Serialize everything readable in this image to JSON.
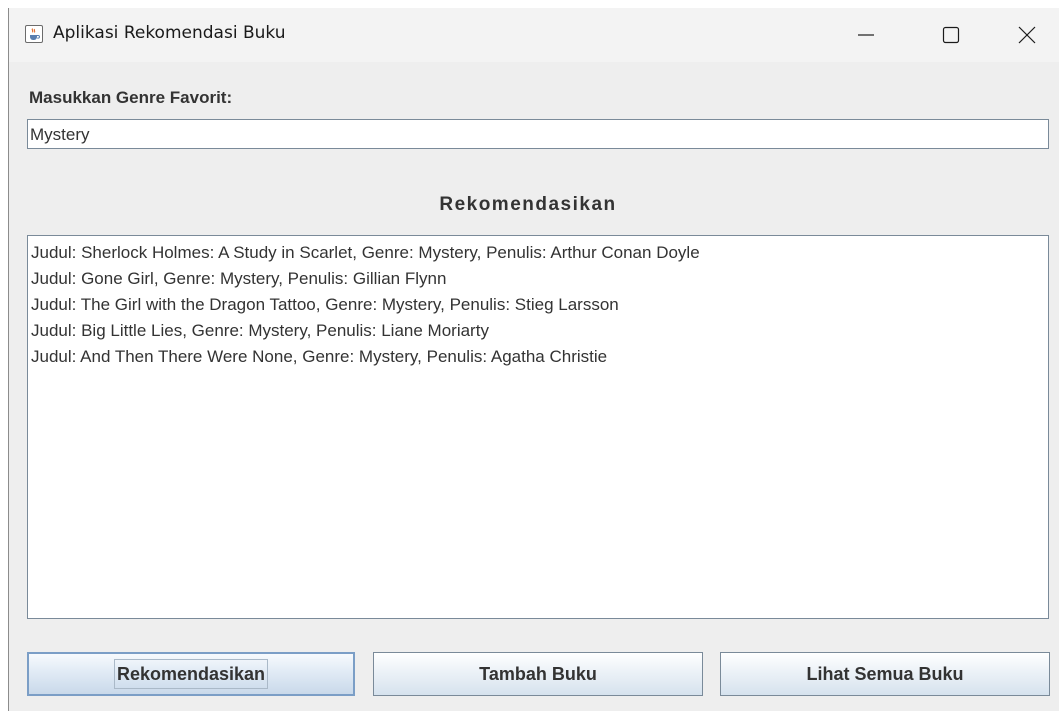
{
  "window": {
    "title": "Aplikasi Rekomendasi Buku",
    "icon": "java-cup-icon",
    "controls": [
      "minimize-icon",
      "maximize-icon",
      "close-icon"
    ]
  },
  "form": {
    "genre_label": "Masukkan Genre Favorit:",
    "genre_value": "Mystery"
  },
  "results": {
    "heading": "Rekomendasikan",
    "lines": [
      "Judul: Sherlock Holmes: A Study in Scarlet, Genre: Mystery, Penulis: Arthur Conan Doyle",
      "Judul: Gone Girl, Genre: Mystery, Penulis: Gillian Flynn",
      "Judul: The Girl with the Dragon Tattoo, Genre: Mystery, Penulis: Stieg Larsson",
      "Judul: Big Little Lies, Genre: Mystery, Penulis: Liane Moriarty",
      "Judul: And Then There Were None, Genre: Mystery, Penulis: Agatha Christie"
    ]
  },
  "buttons": {
    "recommend": "Rekomendasikan",
    "add_book": "Tambah Buku",
    "view_all": "Lihat Semua Buku"
  },
  "colors": {
    "window_bg": "#eeeeee",
    "titlebar_bg": "#f3f3f3",
    "button_border": "#7a8a99",
    "focused_button_border": "#7b9ec6"
  }
}
